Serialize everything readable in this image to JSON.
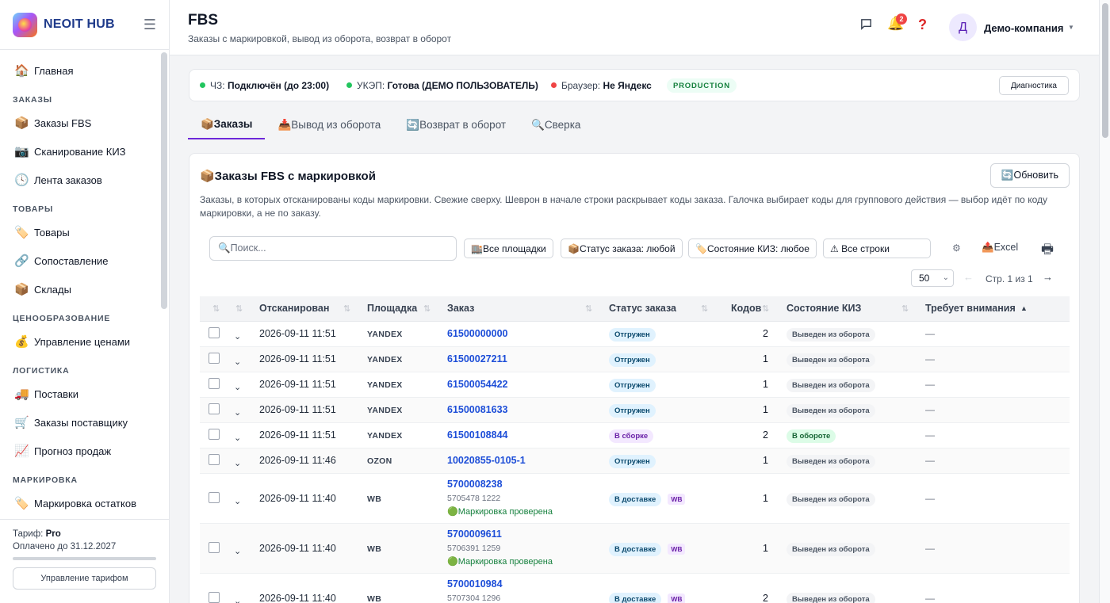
{
  "sidebar": {
    "brand": "NEOIT HUB",
    "items": [
      {
        "kind": "item",
        "icon": "🏠",
        "label": "Главная"
      },
      {
        "kind": "section",
        "label": "ЗАКАЗЫ"
      },
      {
        "kind": "item",
        "icon": "📦",
        "label": "Заказы FBS"
      },
      {
        "kind": "item",
        "icon": "📷",
        "label": "Сканирование КИЗ"
      },
      {
        "kind": "item",
        "icon": "🕓",
        "label": "Лента заказов"
      },
      {
        "kind": "section",
        "label": "ТОВАРЫ"
      },
      {
        "kind": "item",
        "icon": "🏷️",
        "label": "Товары"
      },
      {
        "kind": "item",
        "icon": "🔗",
        "label": "Сопоставление"
      },
      {
        "kind": "item",
        "icon": "📦",
        "label": "Склады"
      },
      {
        "kind": "section",
        "label": "ЦЕНООБРАЗОВАНИЕ"
      },
      {
        "kind": "item",
        "icon": "💰",
        "label": "Управление ценами"
      },
      {
        "kind": "section",
        "label": "ЛОГИСТИКА"
      },
      {
        "kind": "item",
        "icon": "🚚",
        "label": "Поставки"
      },
      {
        "kind": "item",
        "icon": "🛒",
        "label": "Заказы поставщику"
      },
      {
        "kind": "item",
        "icon": "📈",
        "label": "Прогноз продаж"
      },
      {
        "kind": "section",
        "label": "МАРКИРОВКА"
      },
      {
        "kind": "item",
        "icon": "🏷️",
        "label": "Маркировка остатков"
      }
    ],
    "footer": {
      "tariff_label": "Тариф:",
      "tariff_value": "Pro",
      "paid_until": "Оплачено до 31.12.2027",
      "manage_button": "Управление тарифом"
    }
  },
  "header": {
    "title": "FBS",
    "subtitle": "Заказы с маркировкой, вывод из оборота, возврат в оборот",
    "notifications_count": "2",
    "avatar_letter": "Д",
    "company": "Демо-компания"
  },
  "status_bar": {
    "chz_label": "ЧЗ:",
    "chz_value": "Подключён (до 23:00)",
    "ukep_label": "УКЭП:",
    "ukep_value": "Готова (ДЕМО ПОЛЬЗОВАТЕЛЬ)",
    "browser_label": "Браузер:",
    "browser_value": "Не Яндекс",
    "env_badge": "PRODUCTION",
    "diag_button": "Диагностика",
    "colors": {
      "ok": "#22c55e",
      "warn": "#ef4444"
    }
  },
  "tabs": [
    {
      "label": "📦Заказы",
      "active": true
    },
    {
      "label": "📥Вывод из оборота",
      "active": false
    },
    {
      "label": "🔄Возврат в оборот",
      "active": false
    },
    {
      "label": "🔍Сверка",
      "active": false
    }
  ],
  "card": {
    "title": "📦Заказы FBS с маркировкой",
    "refresh_button": "🔄Обновить",
    "description": "Заказы, в которых отсканированы коды маркировки. Свежие сверху. Шеврон в начале строки раскрывает коды заказа. Галочка выбирает коды для группового действия — выбор идёт по коду маркировки, а не по заказу."
  },
  "toolbar": {
    "search_placeholder": "🔍Поиск...",
    "filter_platforms": "🏬Все площадки",
    "filter_order_status": "📦Статус заказа: любой",
    "filter_kiz_state": "🏷️Состояние КИЗ: любое",
    "filter_rows": "⚠ Все строки",
    "excel": "📤Excel",
    "page_size": "50",
    "page_info": "Стр. 1 из 1"
  },
  "table": {
    "columns": {
      "scanned": "Отсканирован",
      "platform": "Площадка",
      "order": "Заказ",
      "order_status": "Статус заказа",
      "codes": "Кодов",
      "kiz_state": "Состояние КИЗ",
      "attention": "Требует внимания",
      "attention_sort": "▲"
    },
    "rows": [
      {
        "scanned": "2026-09-11 11:51",
        "platform": "YANDEX",
        "order": "61500000000",
        "status": "Отгружен",
        "status_kind": "blue",
        "codes": "2",
        "kiz": "Выведен из оборота",
        "kiz_kind": "gray",
        "attention": "—"
      },
      {
        "scanned": "2026-09-11 11:51",
        "platform": "YANDEX",
        "order": "61500027211",
        "status": "Отгружен",
        "status_kind": "blue",
        "codes": "1",
        "kiz": "Выведен из оборота",
        "kiz_kind": "gray",
        "attention": "—"
      },
      {
        "scanned": "2026-09-11 11:51",
        "platform": "YANDEX",
        "order": "61500054422",
        "status": "Отгружен",
        "status_kind": "blue",
        "codes": "1",
        "kiz": "Выведен из оборота",
        "kiz_kind": "gray",
        "attention": "—"
      },
      {
        "scanned": "2026-09-11 11:51",
        "platform": "YANDEX",
        "order": "61500081633",
        "status": "Отгружен",
        "status_kind": "blue",
        "codes": "1",
        "kiz": "Выведен из оборота",
        "kiz_kind": "gray",
        "attention": "—"
      },
      {
        "scanned": "2026-09-11 11:51",
        "platform": "YANDEX",
        "order": "61500108844",
        "status": "В сборке",
        "status_kind": "purple",
        "codes": "2",
        "kiz": "В обороте",
        "kiz_kind": "green",
        "attention": "—"
      },
      {
        "scanned": "2026-09-11 11:46",
        "platform": "OZON",
        "order": "10020855-0105-1",
        "status": "Отгружен",
        "status_kind": "blue",
        "codes": "1",
        "kiz": "Выведен из оборота",
        "kiz_kind": "gray",
        "attention": "—"
      },
      {
        "scanned": "2026-09-11 11:40",
        "platform": "WB",
        "order": "5700008238",
        "order_sub": "5705478 1222",
        "order_check": "🟢Маркировка проверена",
        "status": "В доставке",
        "status_kind": "blue",
        "status_tag": "WB",
        "codes": "1",
        "kiz": "Выведен из оборота",
        "kiz_kind": "gray",
        "attention": "—"
      },
      {
        "scanned": "2026-09-11 11:40",
        "platform": "WB",
        "order": "5700009611",
        "order_sub": "5706391 1259",
        "order_check": "🟢Маркировка проверена",
        "status": "В доставке",
        "status_kind": "blue",
        "status_tag": "WB",
        "codes": "1",
        "kiz": "Выведен из оборота",
        "kiz_kind": "gray",
        "attention": "—"
      },
      {
        "scanned": "2026-09-11 11:40",
        "platform": "WB",
        "order": "5700010984",
        "order_sub": "5707304 1296",
        "status": "В доставке",
        "status_kind": "blue",
        "status_tag": "WB",
        "codes": "2",
        "kiz": "Выведен из оборота",
        "kiz_kind": "gray",
        "attention": "—"
      }
    ]
  }
}
